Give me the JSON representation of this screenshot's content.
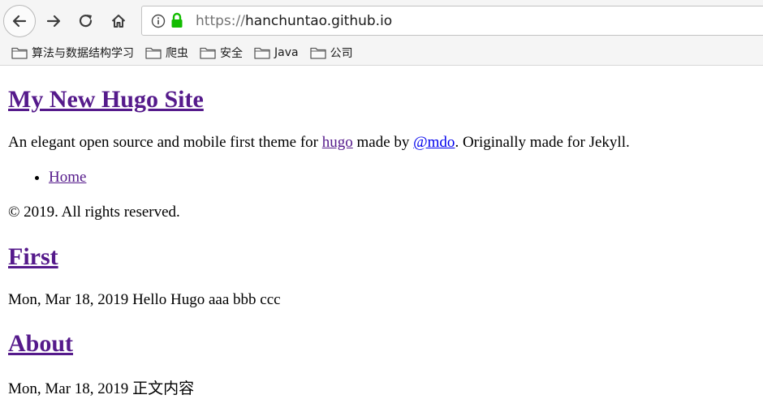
{
  "browser": {
    "url_scheme": "https://",
    "url_host": "hanchuntao.github.io",
    "bookmarks": [
      {
        "label": "算法与数据结构学习",
        "icon": "folder-icon"
      },
      {
        "label": "爬虫",
        "icon": "folder-icon"
      },
      {
        "label": "安全",
        "icon": "folder-icon"
      },
      {
        "label": "Java",
        "icon": "folder-icon"
      },
      {
        "label": "公司",
        "icon": "folder-icon"
      }
    ],
    "lock_color": "#12bc00"
  },
  "site": {
    "title": "My New Hugo Site",
    "desc_prefix": "An elegant open source and mobile first theme for ",
    "desc_hugo_link": "hugo",
    "desc_middle": " made by ",
    "desc_mdo_link": "@mdo",
    "desc_suffix": ". Originally made for Jekyll.",
    "nav": [
      {
        "label": "Home"
      }
    ],
    "copyright": "© 2019. All rights reserved."
  },
  "posts": [
    {
      "title": "First",
      "date": "Mon, Mar 18, 2019",
      "summary": " Hello Hugo aaa bbb ccc"
    },
    {
      "title": "About",
      "date": "Mon, Mar 18, 2019",
      "summary": " 正文内容"
    }
  ]
}
